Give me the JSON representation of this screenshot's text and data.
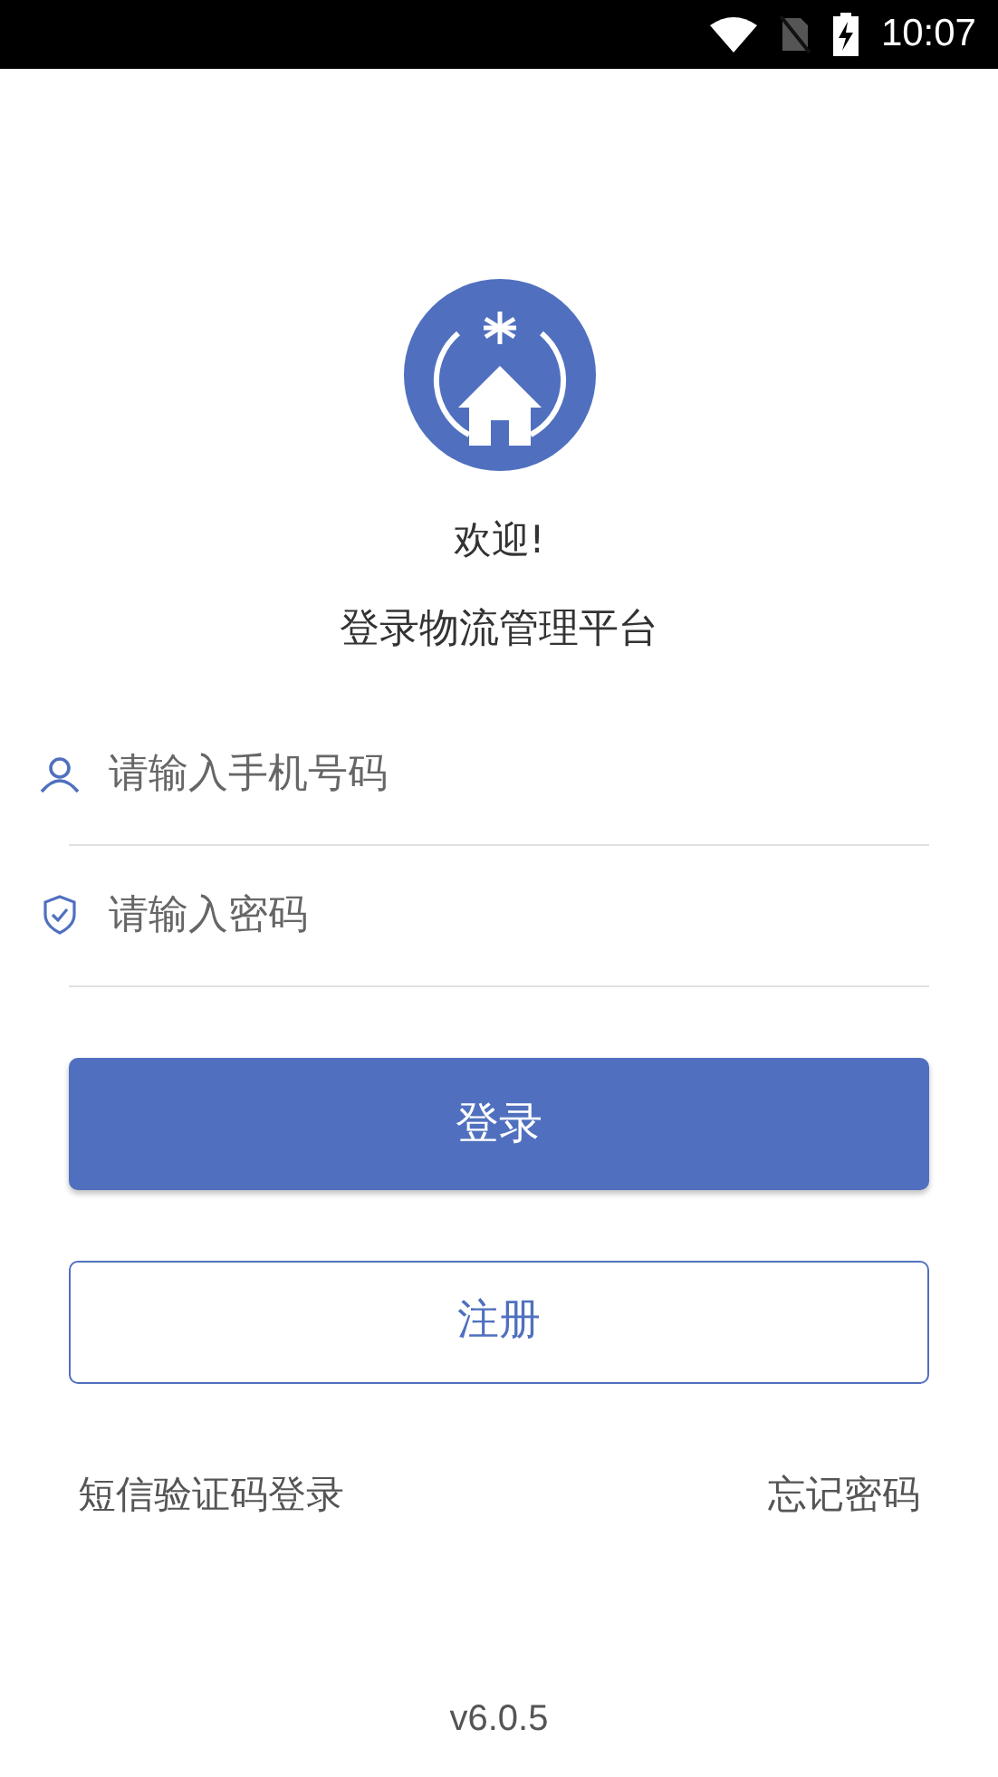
{
  "status_bar": {
    "time": "10:07"
  },
  "welcome": "欢迎!",
  "subtitle": "登录物流管理平台",
  "phone_field": {
    "placeholder": "请输入手机号码"
  },
  "password_field": {
    "placeholder": "请输入密码"
  },
  "login_button": "登录",
  "register_button": "注册",
  "links": [
    "短信验证码登录",
    "忘记密码"
  ],
  "version": "v6.0.5"
}
